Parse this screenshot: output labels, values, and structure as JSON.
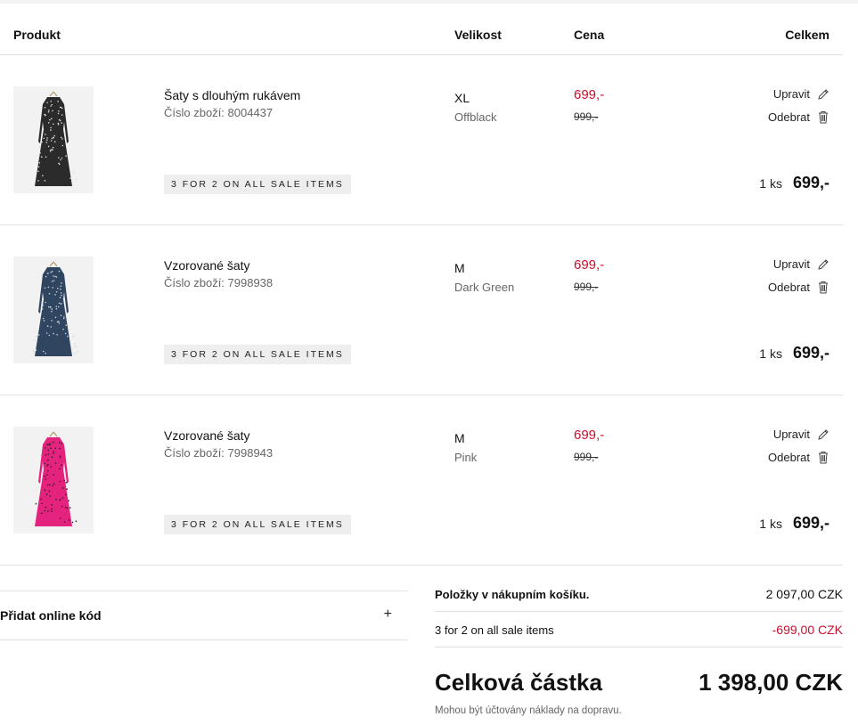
{
  "table_header": {
    "product": "Produkt",
    "size": "Velikost",
    "price": "Cena",
    "total": "Celkem"
  },
  "labels": {
    "sku_prefix": "Číslo zboží: ",
    "edit": "Upravit",
    "remove": "Odebrat",
    "qty_unit": "ks"
  },
  "colors": {
    "sale_red": "#c8102e",
    "promo_bg": "#eeeeee",
    "thumb_bg": "#f2f2f2"
  },
  "items": [
    {
      "name": "Šaty s dlouhým rukávem",
      "sku": "8004437",
      "promo": "3 FOR 2 ON ALL SALE ITEMS",
      "size": "XL",
      "color": "Offblack",
      "price_now": "699,-",
      "price_old": "999,-",
      "qty": "1",
      "line_total": "699,-",
      "dress_color": "#2b2b2b",
      "dot_color": "#d8d8d8"
    },
    {
      "name": "Vzorované šaty",
      "sku": "7998938",
      "promo": "3 FOR 2 ON ALL SALE ITEMS",
      "size": "M",
      "color": "Dark Green",
      "price_now": "699,-",
      "price_old": "999,-",
      "qty": "1",
      "line_total": "699,-",
      "dress_color": "#2f4560",
      "dot_color": "#c9d3dd"
    },
    {
      "name": "Vzorované šaty",
      "sku": "7998943",
      "promo": "3 FOR 2 ON ALL SALE ITEMS",
      "size": "M",
      "color": "Pink",
      "price_now": "699,-",
      "price_old": "999,-",
      "qty": "1",
      "line_total": "699,-",
      "dress_color": "#e4237f",
      "dot_color": "#2a1a22"
    }
  ],
  "online_code": {
    "label": "Přidat online kód",
    "expand_icon": "+"
  },
  "summary": {
    "items_label": "Položky v nákupním košíku.",
    "items_value": "2 097,00 CZK",
    "discount_label": "3 for 2 on all sale items",
    "discount_value": "-699,00 CZK",
    "total_label": "Celková částka",
    "total_value": "1 398,00 CZK",
    "shipping_note": "Mohou být účtovány náklady na dopravu."
  }
}
